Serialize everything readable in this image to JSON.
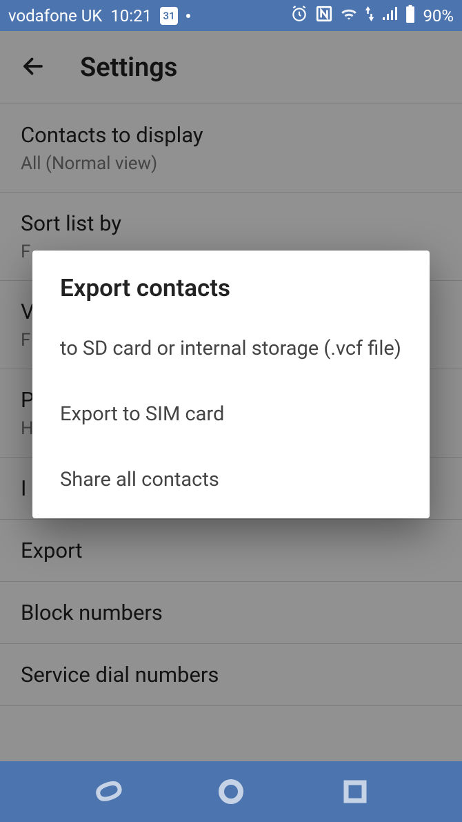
{
  "status": {
    "carrier": "vodafone UK",
    "time": "10:21",
    "calendar_day": "31",
    "battery_pct": "90%"
  },
  "header": {
    "title": "Settings"
  },
  "settings": {
    "items": [
      {
        "primary": "Contacts to display",
        "secondary": "All (Normal view)"
      },
      {
        "primary": "Sort list by",
        "secondary": "F"
      },
      {
        "primary": "V",
        "secondary": "F"
      },
      {
        "primary": "P",
        "secondary": "H"
      },
      {
        "primary": "I",
        "secondary": ""
      },
      {
        "primary": "Export",
        "secondary": ""
      },
      {
        "primary": "Block numbers",
        "secondary": ""
      },
      {
        "primary": "Service dial numbers",
        "secondary": ""
      }
    ]
  },
  "dialog": {
    "title": "Export contacts",
    "options": [
      "to SD card or internal storage (.vcf file)",
      "Export to SIM card",
      "Share all contacts"
    ]
  }
}
